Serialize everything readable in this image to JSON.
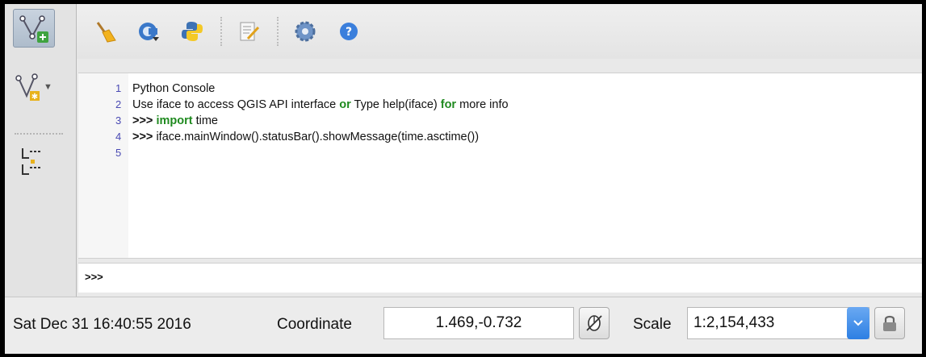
{
  "console": {
    "lines": [
      {
        "num": "1",
        "parts": [
          {
            "text": "Python Console",
            "kw": false
          }
        ]
      },
      {
        "num": "2",
        "parts": [
          {
            "text": "Use iface to access QGIS API interface ",
            "kw": false
          },
          {
            "text": "or",
            "kw": true
          },
          {
            "text": " Type help(iface) ",
            "kw": false
          },
          {
            "text": "for",
            "kw": true
          },
          {
            "text": " more info",
            "kw": false
          }
        ]
      },
      {
        "num": "3",
        "parts": [
          {
            "text": ">>> ",
            "prompt": true
          },
          {
            "text": "import",
            "kw": true
          },
          {
            "text": " time",
            "kw": false
          }
        ]
      },
      {
        "num": "4",
        "parts": [
          {
            "text": ">>> ",
            "prompt": true
          },
          {
            "text": "iface.mainWindow().statusBar().showMessage(time.asctime())",
            "kw": false
          }
        ]
      },
      {
        "num": "5",
        "parts": []
      }
    ],
    "input_prompt": ">>>",
    "input_value": ""
  },
  "toolbar_icons": [
    "clear-console-icon",
    "run-command-icon",
    "python-editor-icon",
    "edit-script-icon",
    "settings-icon",
    "help-icon"
  ],
  "left_toolbar_icons": [
    "add-feature-icon",
    "vertex-tool-icon",
    "node-tool-icon"
  ],
  "statusbar": {
    "message": "Sat Dec 31 16:40:55 2016",
    "coordinate_label": "Coordinate",
    "coordinate_value": "1.469,-0.732",
    "scale_label": "Scale",
    "scale_value": "1:2,154,433"
  },
  "colors": {
    "keyword": "#1f8a1f",
    "line_number": "#4a4ab3",
    "combo_accent": "#2d7fe3"
  }
}
